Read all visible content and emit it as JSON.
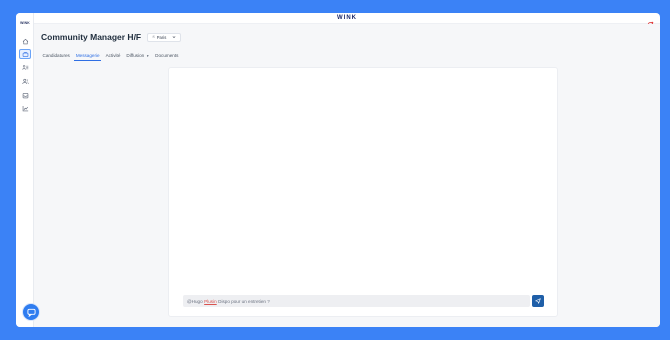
{
  "app": {
    "brand": "WINK",
    "sidebar_logo": "WINK"
  },
  "sidebar": {
    "items": [
      {
        "name": "home",
        "icon": "home-icon",
        "active": false
      },
      {
        "name": "jobs",
        "icon": "briefcase-icon",
        "active": true
      },
      {
        "name": "candidates",
        "icon": "candidates-icon",
        "active": false
      },
      {
        "name": "users",
        "icon": "users-icon",
        "active": false
      },
      {
        "name": "inbox",
        "icon": "inbox-icon",
        "active": false
      },
      {
        "name": "analytics",
        "icon": "chart-icon",
        "active": false
      }
    ]
  },
  "page": {
    "title": "Community Manager H/F",
    "location_select": "Paris"
  },
  "tabs": [
    {
      "label": "Candidatures",
      "active": false
    },
    {
      "label": "Messagerie",
      "active": true
    },
    {
      "label": "Activité",
      "active": false
    },
    {
      "label": "Diffusion",
      "active": false,
      "has_dropdown": true
    },
    {
      "label": "Documents",
      "active": false
    }
  ],
  "composer": {
    "mention_prefix": "@Hugo",
    "mention_name": "Plusin",
    "message_text": "Dispo pour un entretien ?"
  },
  "colors": {
    "background": "#3b82f6",
    "accent": "#2f6fe4",
    "send_button": "#1f5fa8"
  }
}
